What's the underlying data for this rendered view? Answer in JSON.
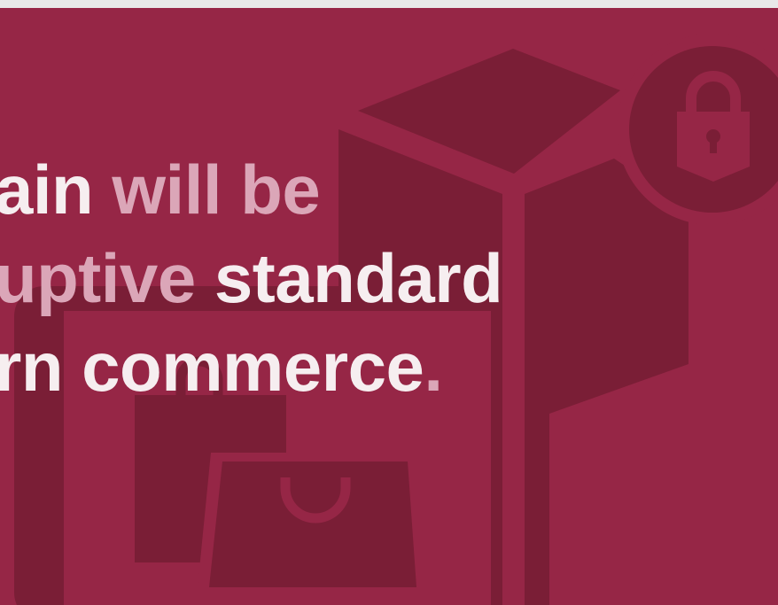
{
  "banner": {
    "colors": {
      "background": "#962646",
      "shape": "#7a1e36",
      "text_strong": "#f6eef0",
      "text_soft": "#dba6b8",
      "top_strip": "#e8e8e8"
    },
    "icons": [
      "package-box-icon",
      "padlock-icon",
      "smartphone-icon",
      "shopping-bag-icon"
    ],
    "headline": {
      "line1_a": "ain ",
      "line1_b": "will be",
      "line2_a": "uptive ",
      "line2_b": "standard",
      "line3_a": "rn commerce",
      "line3_b": "."
    }
  }
}
